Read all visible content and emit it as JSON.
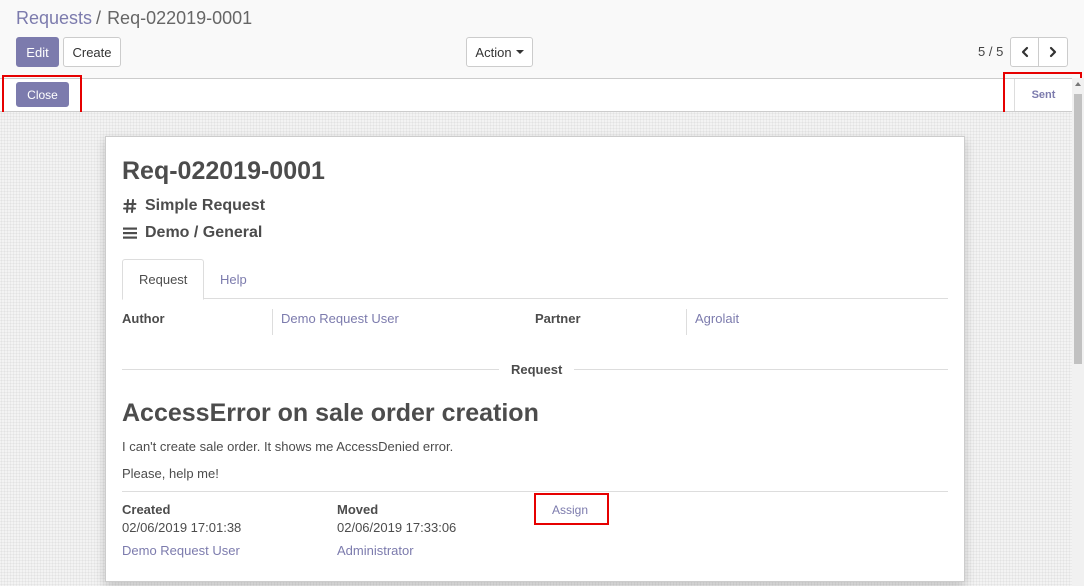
{
  "breadcrumb": {
    "parent": "Requests",
    "separator": "/",
    "current": "Req-022019-0001"
  },
  "toolbar": {
    "edit_label": "Edit",
    "create_label": "Create",
    "action_label": "Action",
    "pager_value": "5 / 5"
  },
  "statusbar": {
    "close_label": "Close",
    "current_stage": "Sent"
  },
  "record": {
    "name": "Req-022019-0001",
    "type": "Simple Request",
    "category": "Demo / General",
    "tabs": [
      {
        "label": "Request",
        "active": true
      },
      {
        "label": "Help",
        "active": false
      }
    ],
    "fields": {
      "author_label": "Author",
      "author_value": "Demo Request User",
      "partner_label": "Partner",
      "partner_value": "Agrolait"
    },
    "separator_label": "Request",
    "request_title": "AccessError on sale order creation",
    "request_body": [
      "I can't create sale order. It shows me AccessDenied error.",
      "Please, help me!"
    ],
    "history": {
      "created_label": "Created",
      "created_date": "02/06/2019 17:01:38",
      "created_by": "Demo Request User",
      "moved_label": "Moved",
      "moved_date": "02/06/2019 17:33:06",
      "moved_by": "Administrator",
      "assign_label": "Assign"
    }
  },
  "icons": {
    "type_icon": "hash-icon",
    "category_icon": "bars-icon",
    "pager_prev": "chevron-left-icon",
    "pager_next": "chevron-right-icon",
    "action_caret": "caret-down-icon"
  },
  "colors": {
    "primary": "#7c7bad",
    "text": "#4c4c4c",
    "annotation": "#e60000"
  }
}
